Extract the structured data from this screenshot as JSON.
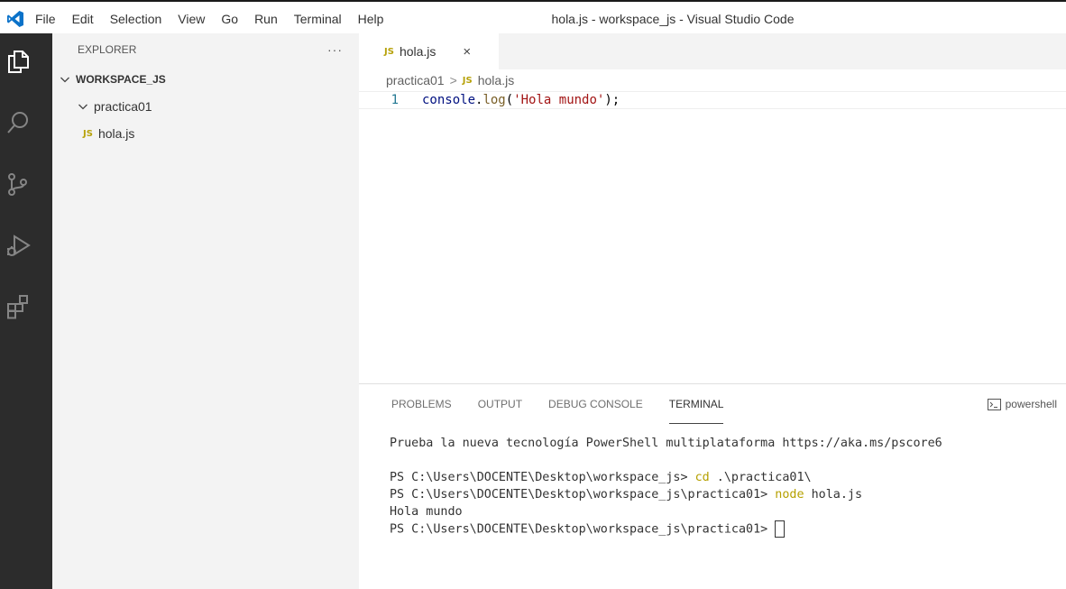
{
  "titlebar": {
    "menu": [
      "File",
      "Edit",
      "Selection",
      "View",
      "Go",
      "Run",
      "Terminal",
      "Help"
    ],
    "window_title": "hola.js - workspace_js - Visual Studio Code"
  },
  "activity_bar": {
    "icons": [
      "files-icon",
      "search-icon",
      "source-control-icon",
      "run-debug-icon",
      "extensions-icon"
    ]
  },
  "sidebar": {
    "title": "EXPLORER",
    "more": "···",
    "workspace": "WORKSPACE_JS",
    "folder": "practica01",
    "file_badge": "JS",
    "file": "hola.js"
  },
  "editor": {
    "tab": {
      "badge": "JS",
      "label": "hola.js",
      "close": "×"
    },
    "breadcrumb": {
      "folder": "practica01",
      "separator": ">",
      "badge": "JS",
      "file": "hola.js"
    },
    "lines": [
      {
        "number": "1",
        "obj": "console",
        "dot": ".",
        "fn": "log",
        "open": "(",
        "str": "'Hola mundo'",
        "close": ");"
      }
    ]
  },
  "panel": {
    "tabs": [
      "PROBLEMS",
      "OUTPUT",
      "DEBUG CONSOLE",
      "TERMINAL"
    ],
    "active_tab": "TERMINAL",
    "terminal_type": "powershell",
    "terminal": {
      "banner": "Prueba la nueva tecnología PowerShell multiplataforma https://aka.ms/pscore6",
      "line1_prompt": "PS C:\\Users\\DOCENTE\\Desktop\\workspace_js> ",
      "line1_cmd": "cd",
      "line1_arg": " .\\practica01\\",
      "line2_prompt": "PS C:\\Users\\DOCENTE\\Desktop\\workspace_js\\practica01> ",
      "line2_cmd": "node",
      "line2_arg": " hola.js",
      "output": "Hola mundo",
      "line3_prompt": "PS C:\\Users\\DOCENTE\\Desktop\\workspace_js\\practica01> "
    }
  },
  "colors": {
    "activity_bar": "#2c2c2c",
    "sidebar": "#f3f3f3",
    "js_badge": "#b7a20b",
    "keyword": "#b5a000",
    "string": "#a31515",
    "line_number": "#237893"
  }
}
